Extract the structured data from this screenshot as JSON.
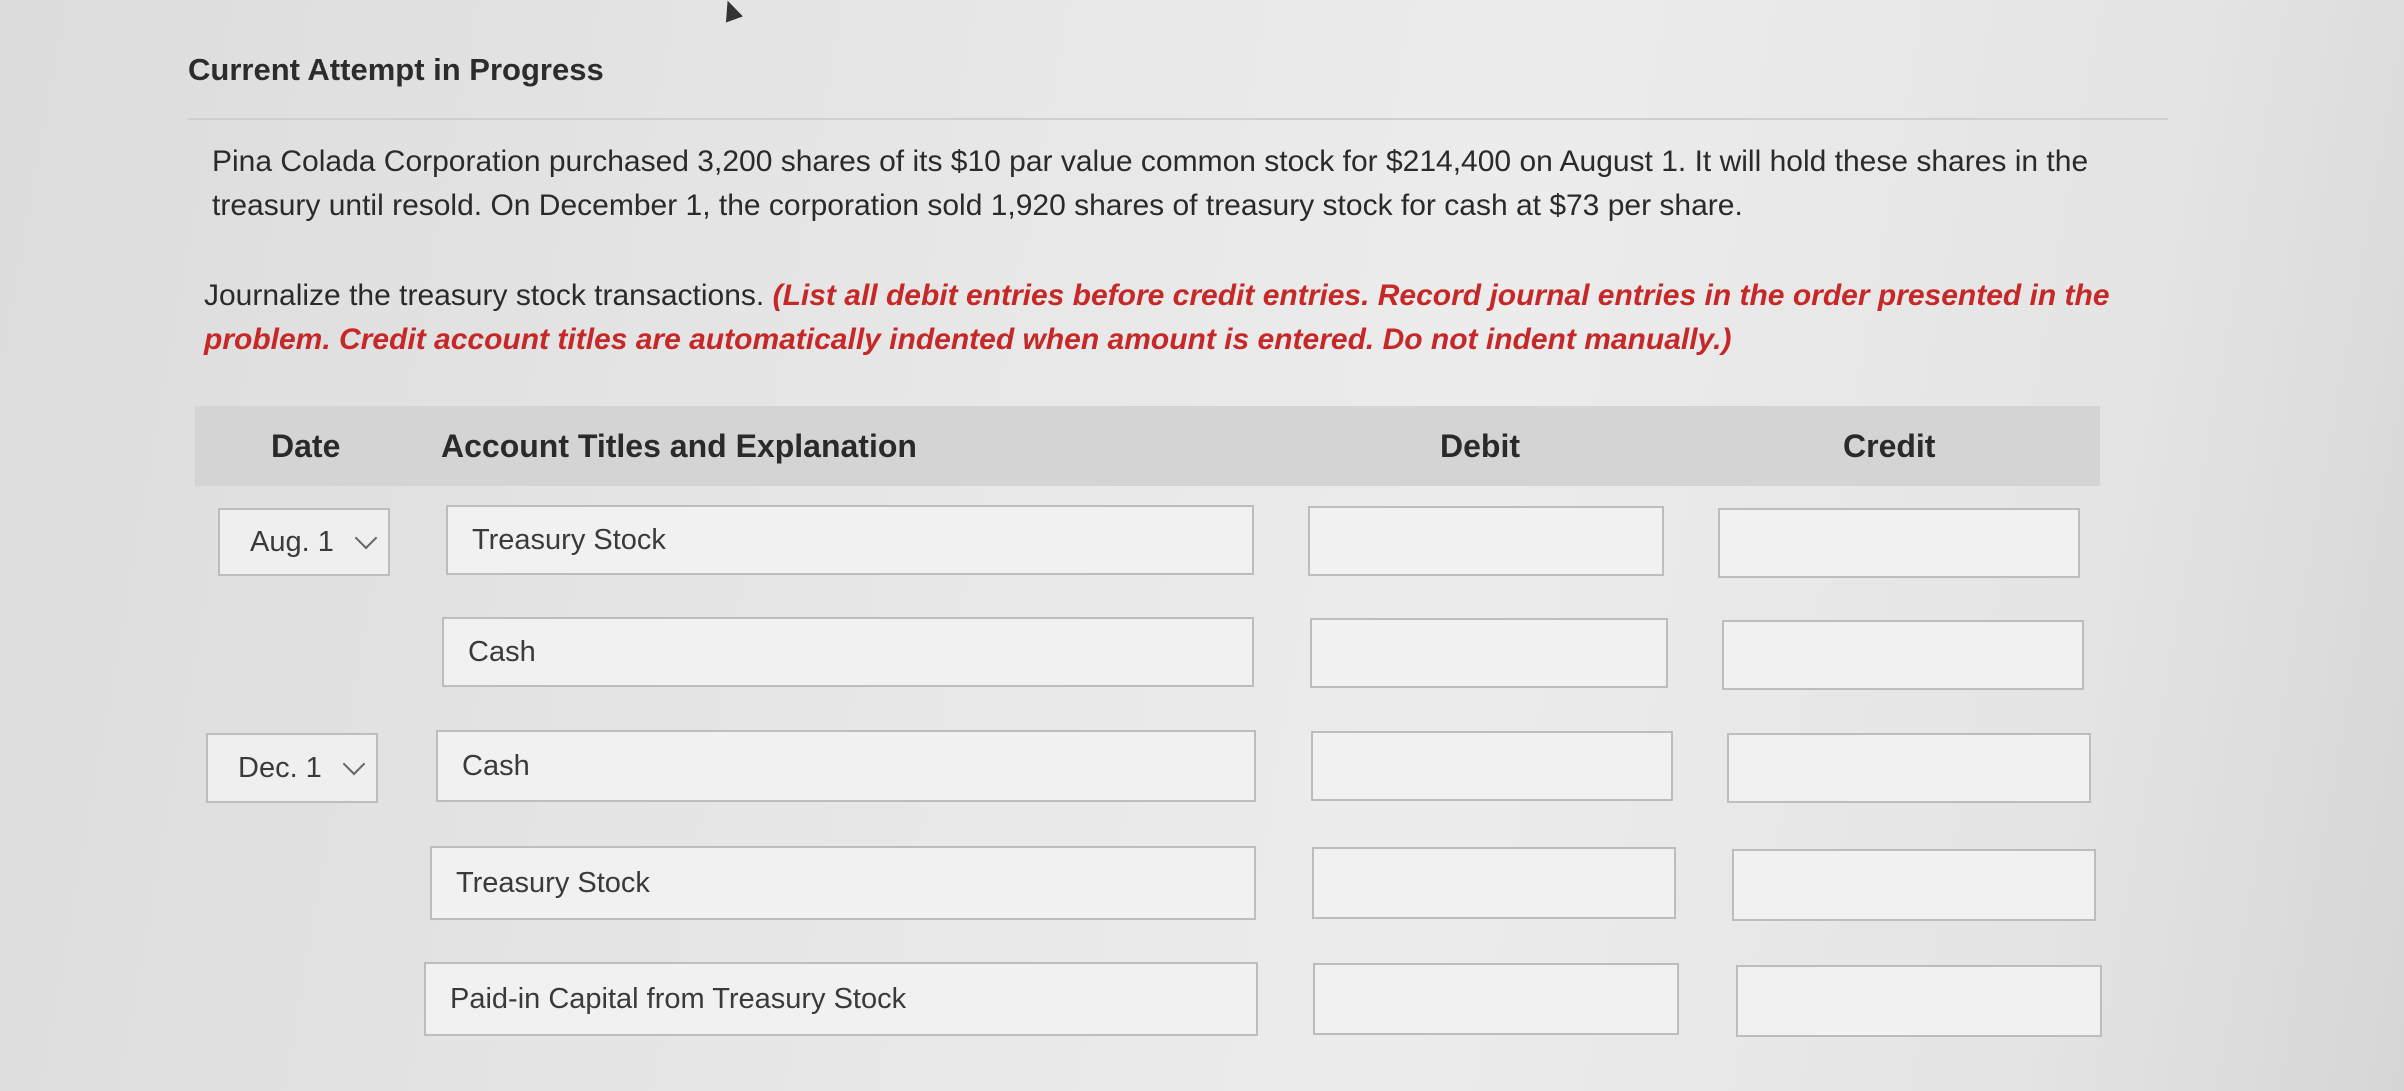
{
  "header": {
    "title": "Current Attempt in Progress"
  },
  "problem": {
    "text": "Pina Colada Corporation purchased 3,200 shares of its $10 par value common stock for $214,400 on August 1. It will hold these shares in the treasury until resold. On December 1, the corporation sold 1,920 shares of treasury stock for cash at $73 per share."
  },
  "instructions": {
    "lead": "Journalize the treasury stock transactions. ",
    "note": "(List all debit entries before credit entries. Record journal entries in the order presented in the problem. Credit account titles are automatically indented when amount is entered. Do not indent manually.)"
  },
  "table": {
    "headers": {
      "date": "Date",
      "account": "Account Titles and Explanation",
      "debit": "Debit",
      "credit": "Credit"
    },
    "rows": [
      {
        "date": "Aug. 1",
        "account": "Treasury Stock",
        "debit": "",
        "credit": ""
      },
      {
        "date": "",
        "account": "Cash",
        "debit": "",
        "credit": ""
      },
      {
        "date": "Dec. 1",
        "account": "Cash",
        "debit": "",
        "credit": ""
      },
      {
        "date": "",
        "account": "Treasury Stock",
        "debit": "",
        "credit": ""
      },
      {
        "date": "",
        "account": "Paid-in Capital from Treasury Stock",
        "debit": "",
        "credit": ""
      }
    ]
  },
  "icons": {
    "cursor": "mouse-pointer-icon",
    "dropdown": "chevron-down-icon"
  }
}
